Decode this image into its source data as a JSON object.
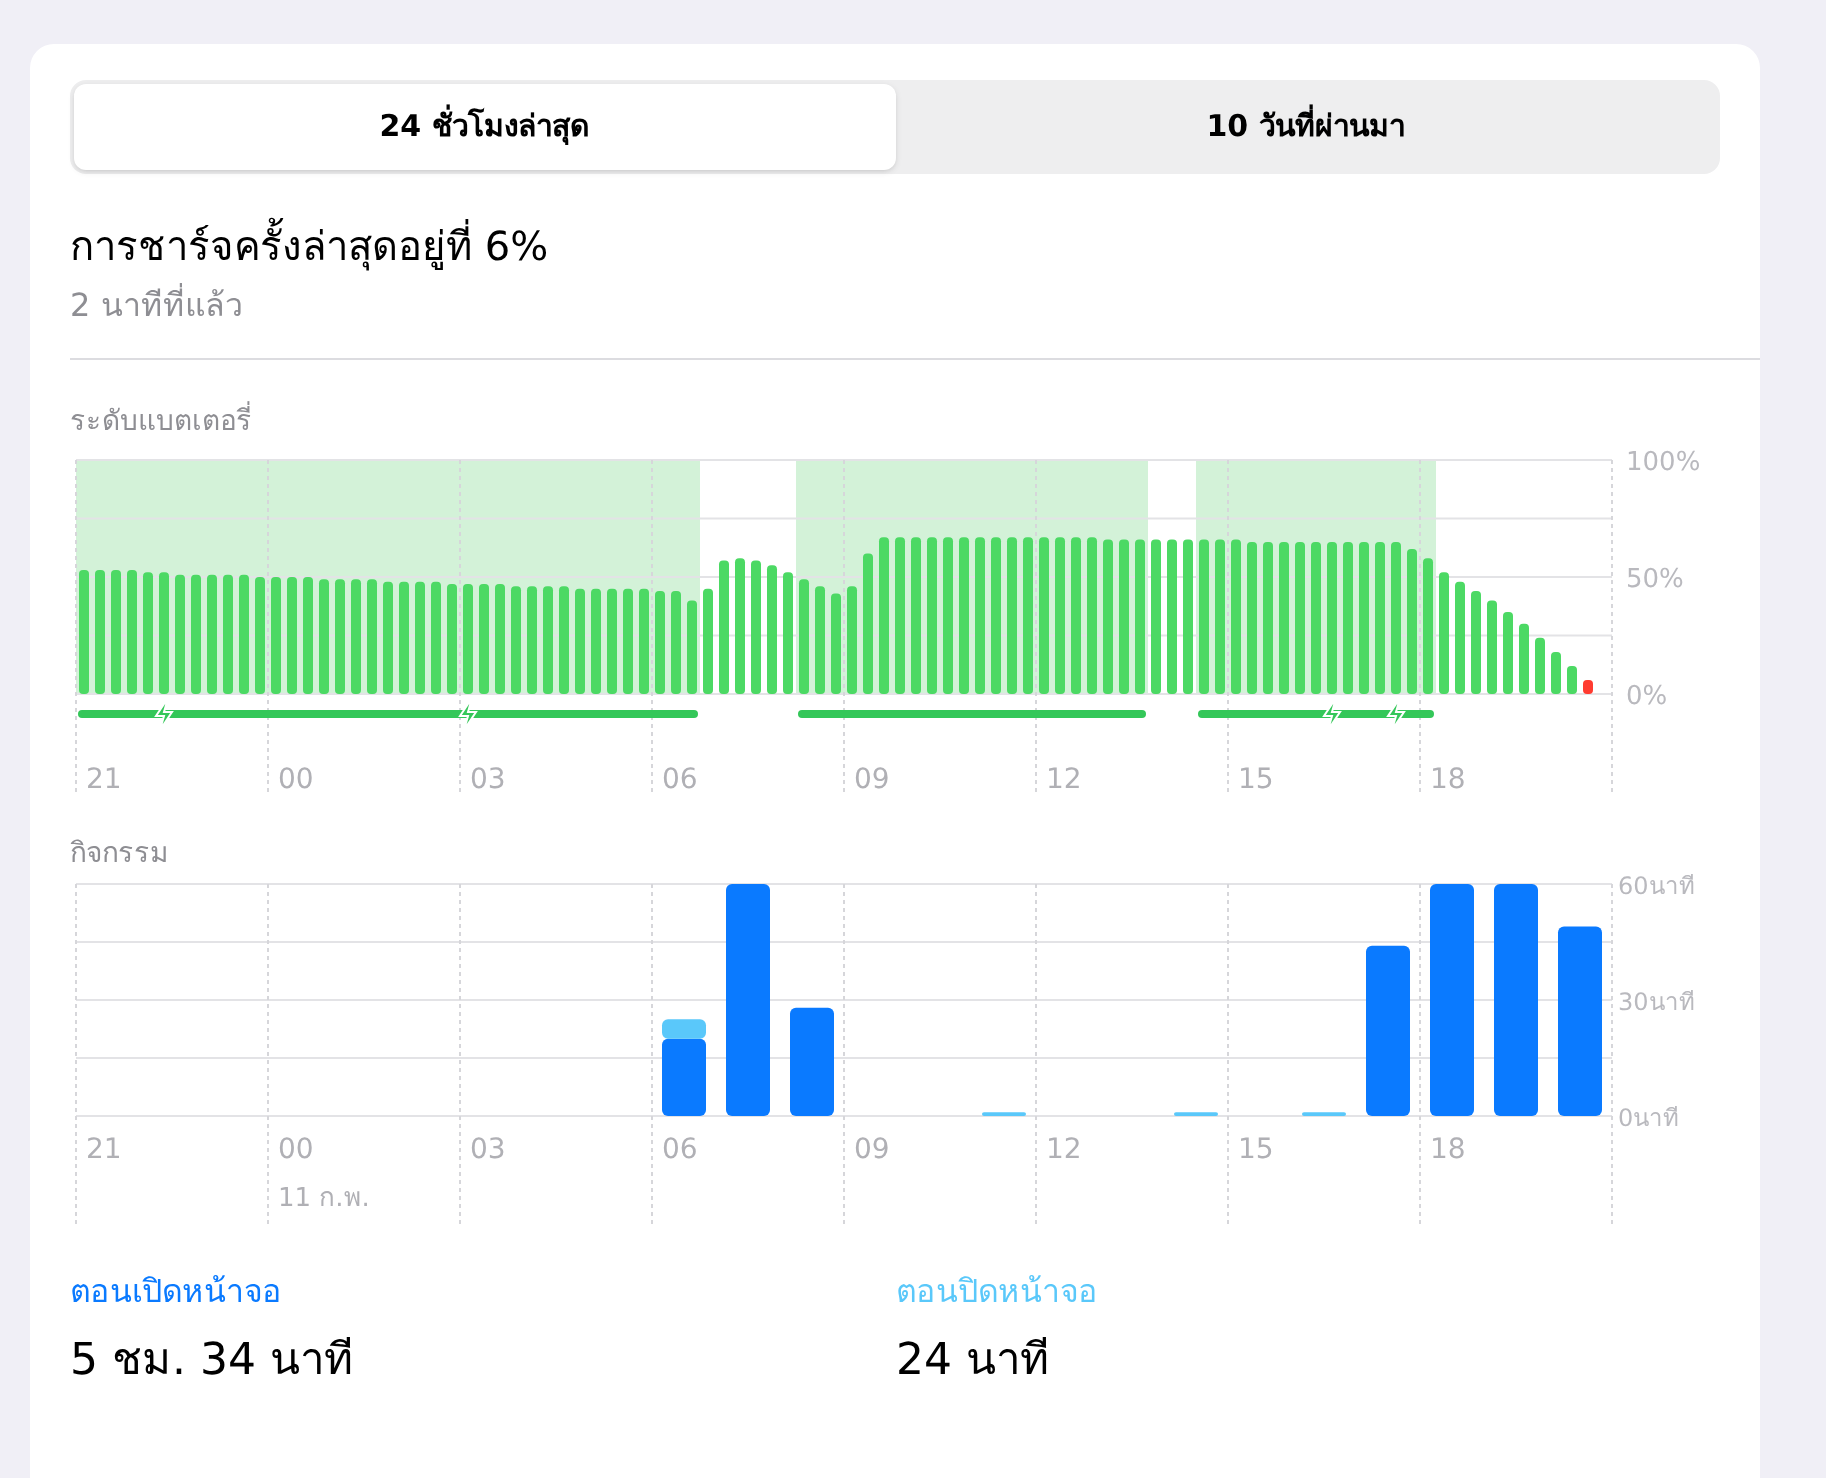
{
  "tabs": [
    {
      "label": "24 ชั่วโมงล่าสุด",
      "selected": true
    },
    {
      "label": "10 วันที่ผ่านมา",
      "selected": false
    }
  ],
  "last_charge": {
    "title": "การชาร์จครั้งล่าสุดอยู่ที่ 6%",
    "time": "2 นาทีที่แล้ว"
  },
  "battery_chart": {
    "label": "ระดับแบตเตอรี่",
    "charging": [
      true,
      true,
      true,
      true,
      true,
      true,
      true,
      true,
      true,
      true,
      true,
      true,
      true,
      true,
      true,
      true,
      true,
      true,
      true,
      true,
      true,
      true,
      true,
      true,
      true,
      true,
      true,
      true,
      true,
      true,
      true,
      true,
      true,
      true,
      true,
      true,
      true,
      true,
      true,
      false,
      false,
      false,
      false,
      false,
      false,
      true,
      true,
      true,
      true,
      true,
      true,
      true,
      true,
      true,
      true,
      true,
      true,
      true,
      true,
      true,
      true,
      true,
      true,
      true,
      true,
      true,
      true,
      false,
      false,
      false,
      true,
      true,
      true,
      true,
      true,
      true,
      true,
      true,
      true,
      true,
      true,
      true,
      true,
      true,
      true,
      false,
      false,
      false,
      false,
      false,
      false,
      false,
      false,
      false,
      false
    ],
    "bolts": [
      false,
      false,
      false,
      false,
      false,
      true,
      false,
      false,
      false,
      false,
      false,
      false,
      false,
      false,
      false,
      false,
      false,
      false,
      false,
      false,
      false,
      false,
      false,
      false,
      true,
      false,
      false,
      false,
      false,
      false,
      false,
      false,
      false,
      false,
      false,
      false,
      false,
      false,
      false,
      false,
      false,
      false,
      false,
      false,
      false,
      false,
      false,
      false,
      false,
      false,
      false,
      false,
      false,
      false,
      false,
      false,
      false,
      false,
      false,
      false,
      false,
      false,
      false,
      false,
      false,
      false,
      false,
      false,
      false,
      false,
      false,
      false,
      false,
      false,
      false,
      false,
      false,
      false,
      true,
      false,
      false,
      false,
      true,
      false,
      false,
      false,
      false,
      false,
      false,
      false,
      false,
      false,
      false,
      false,
      false
    ],
    "chart_data": {
      "type": "bar",
      "categories": [
        null,
        "21",
        null,
        null,
        null,
        null,
        null,
        null,
        null,
        null,
        null,
        null,
        null,
        "00",
        null,
        null,
        null,
        null,
        null,
        null,
        null,
        null,
        null,
        null,
        null,
        "03",
        null,
        null,
        null,
        null,
        null,
        null,
        null,
        null,
        null,
        null,
        null,
        "06",
        null,
        null,
        null,
        null,
        null,
        null,
        null,
        null,
        null,
        null,
        null,
        "09",
        null,
        null,
        null,
        null,
        null,
        null,
        null,
        null,
        null,
        null,
        null,
        "12",
        null,
        null,
        null,
        null,
        null,
        null,
        null,
        null,
        null,
        null,
        null,
        "15",
        null,
        null,
        null,
        null,
        null,
        null,
        null,
        null,
        null,
        null,
        null,
        "18",
        null,
        null,
        null,
        null,
        null,
        null,
        null,
        null,
        null,
        null
      ],
      "yticks": [
        {
          "value": 0,
          "label": "0%"
        },
        {
          "value": 50,
          "label": "50%"
        },
        {
          "value": 100,
          "label": "100%"
        }
      ],
      "ylim": [
        0,
        100
      ],
      "stacked": true,
      "series": [
        {
          "color": "#4cd964",
          "values": [
            53,
            53,
            53,
            53,
            52,
            52,
            51,
            51,
            51,
            51,
            51,
            50,
            50,
            50,
            50,
            49,
            49,
            49,
            49,
            48,
            48,
            48,
            48,
            47,
            47,
            47,
            47,
            46,
            46,
            46,
            46,
            45,
            45,
            45,
            45,
            45,
            44,
            44,
            40,
            45,
            57,
            58,
            57,
            55,
            52,
            49,
            46,
            43,
            46,
            60,
            67,
            67,
            67,
            67,
            67,
            67,
            67,
            67,
            67,
            67,
            67,
            67,
            67,
            67,
            66,
            66,
            66,
            66,
            66,
            66,
            66,
            66,
            66,
            65,
            65,
            65,
            65,
            65,
            65,
            65,
            65,
            65,
            65,
            62,
            58,
            52,
            48,
            44,
            40,
            35,
            30,
            24,
            18,
            12,
            null,
            null
          ]
        },
        {
          "color": "#ff3b30",
          "values": [
            null,
            null,
            null,
            null,
            null,
            null,
            null,
            null,
            null,
            null,
            null,
            null,
            null,
            null,
            null,
            null,
            null,
            null,
            null,
            null,
            null,
            null,
            null,
            null,
            null,
            null,
            null,
            null,
            null,
            null,
            null,
            null,
            null,
            null,
            null,
            null,
            null,
            null,
            null,
            null,
            null,
            null,
            null,
            null,
            null,
            null,
            null,
            null,
            null,
            null,
            null,
            null,
            null,
            null,
            null,
            null,
            null,
            null,
            null,
            null,
            null,
            null,
            null,
            null,
            null,
            null,
            null,
            null,
            null,
            null,
            null,
            null,
            null,
            null,
            null,
            null,
            null,
            null,
            null,
            null,
            null,
            null,
            null,
            null,
            null,
            null,
            null,
            null,
            null,
            null,
            null,
            null,
            null,
            null,
            6,
            null
          ]
        }
      ]
    }
  },
  "activity_chart": {
    "label": "กิจกรรม",
    "date_label": "11 ก.พ.",
    "chart_data": {
      "type": "bar",
      "stacked": true,
      "categories": [
        "21",
        null,
        null,
        "00",
        null,
        null,
        "03",
        null,
        null,
        "06",
        null,
        null,
        "09",
        null,
        null,
        "12",
        null,
        null,
        "15",
        null,
        null,
        "18",
        null,
        null
      ],
      "yticks": [
        {
          "value": 0,
          "label": "0นาที"
        },
        {
          "value": 30,
          "label": "30นาที"
        },
        {
          "value": 60,
          "label": "60นาที"
        }
      ],
      "ylim": [
        0,
        60
      ],
      "series": [
        {
          "color": "#0a7aff",
          "values": [
            0,
            0,
            0,
            0,
            0,
            0,
            0,
            0,
            0,
            20,
            60,
            28,
            0,
            0,
            0,
            0,
            0,
            0,
            0,
            0,
            44,
            60,
            60,
            49
          ]
        },
        {
          "color": "#5ac8fa",
          "values": [
            0,
            0,
            0,
            0,
            0,
            0,
            0,
            0,
            0,
            5,
            0,
            0,
            0,
            0,
            1,
            0,
            0,
            1,
            0,
            1,
            0,
            0,
            0,
            0
          ]
        }
      ]
    }
  },
  "legend": [
    {
      "label": "ตอนเปิดหน้าจอ",
      "value": "5 ชม. 34 นาที",
      "color": "#0a7aff"
    },
    {
      "label": "ตอนปิดหน้าจอ",
      "value": "24 นาที",
      "color": "#5ac8fa"
    }
  ]
}
